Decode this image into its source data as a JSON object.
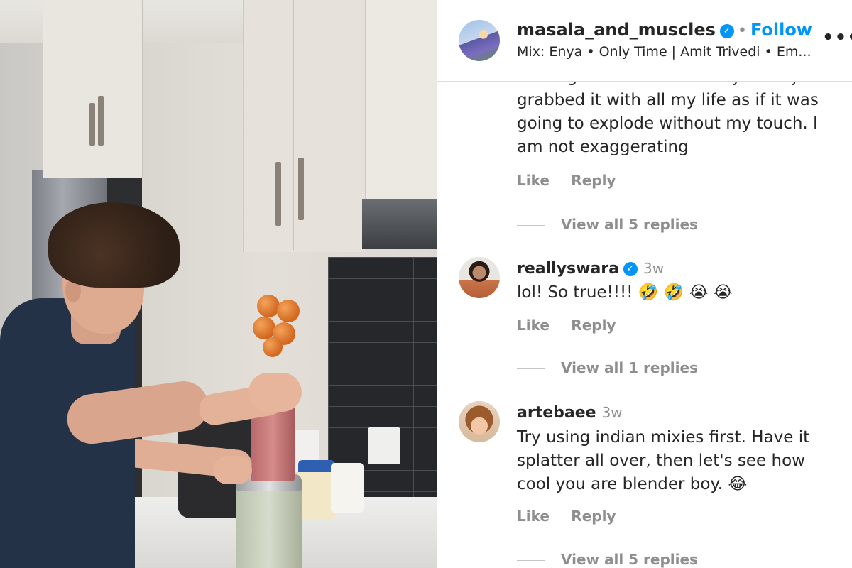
{
  "post": {
    "username": "masala_and_muscles",
    "verified_glyph": "✓",
    "separator": "•",
    "follow_label": "Follow",
    "audio": "Mix: Enya • Only Time | Amit Trivedi • Em...",
    "more_glyph": "•••",
    "icons": {
      "more": "more-options-icon",
      "verified": "verified-badge-icon"
    }
  },
  "comments": [
    {
      "clipped": true,
      "text": "holding it and I had anxiety and I just grabbed it with all my life as if it was going to explode without my touch. I am not exaggerating",
      "like_label": "Like",
      "reply_label": "Reply",
      "view_replies": "View all 5 replies"
    },
    {
      "username": "reallyswara",
      "verified": true,
      "time": "3w",
      "text": "lol! So true!!!! 🤣 🤣 😭 😭",
      "like_label": "Like",
      "reply_label": "Reply",
      "view_replies": "View all 1 replies"
    },
    {
      "username": "artebaee",
      "verified": false,
      "time": "3w",
      "text": "Try using indian mixies first. Have it splatter all over, then let's see how cool you are blender boy. 😂",
      "like_label": "Like",
      "reply_label": "Reply",
      "view_replies": "View all 5 replies"
    }
  ],
  "colors": {
    "link": "#0095f6",
    "muted": "#8e8e8e",
    "text": "#262626"
  }
}
